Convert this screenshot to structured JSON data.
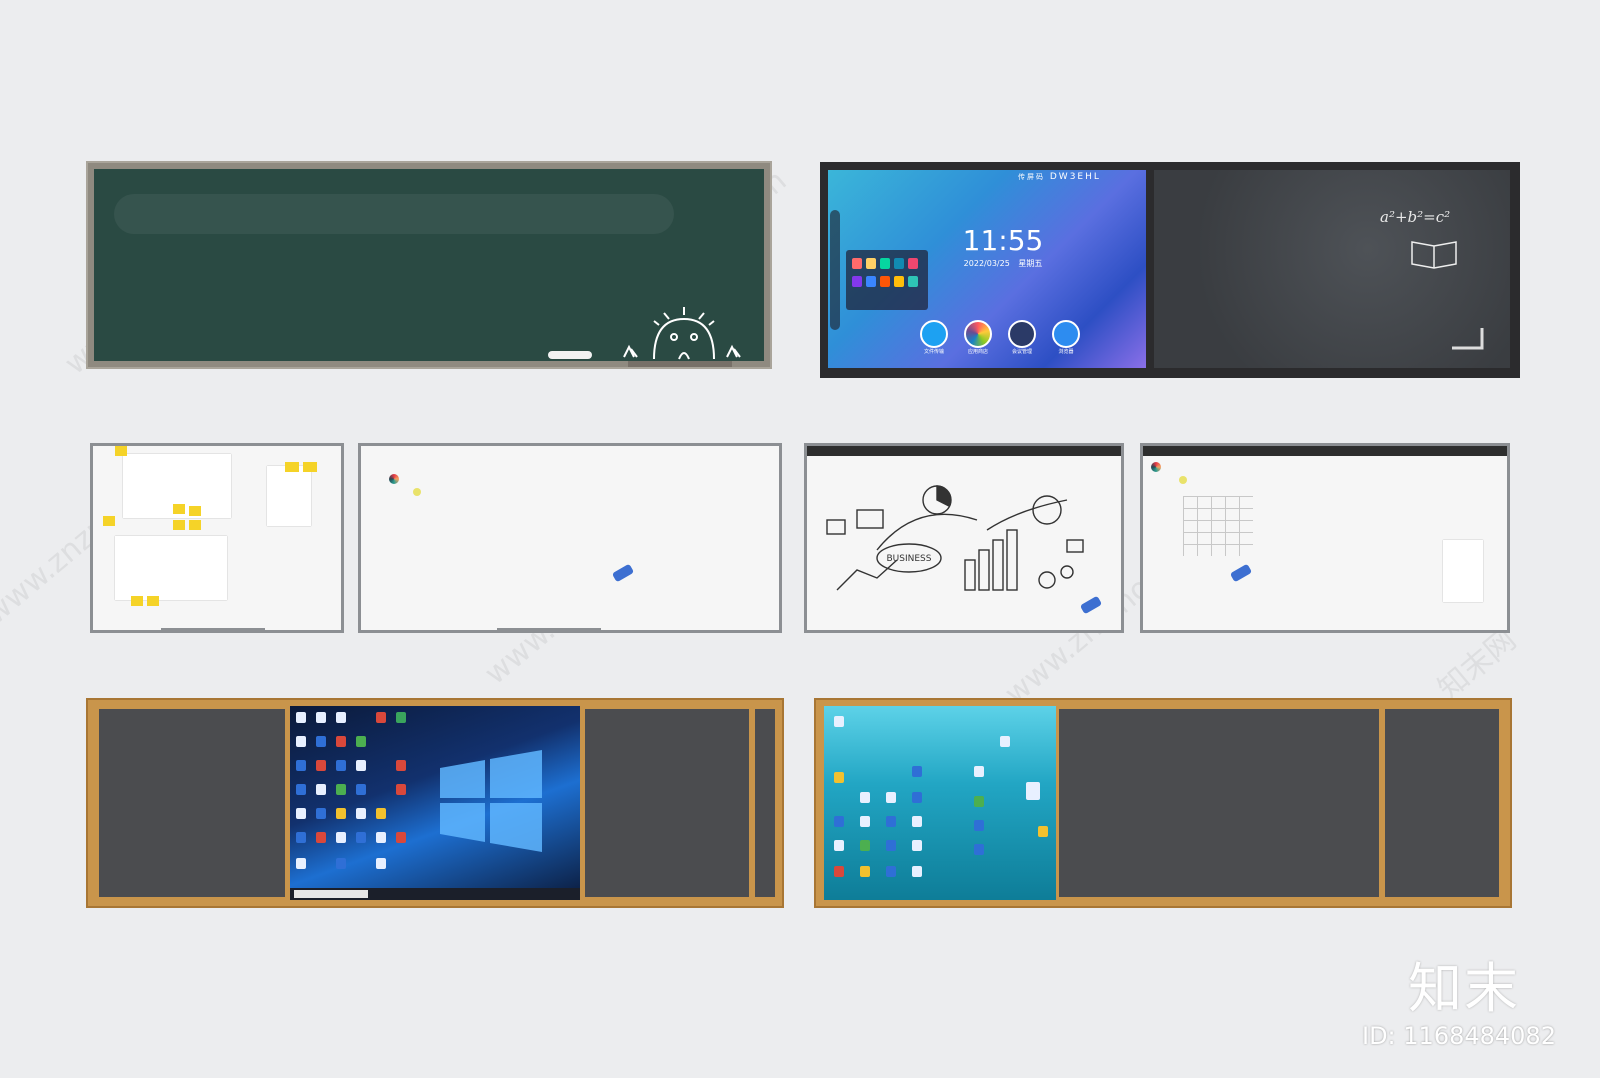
{
  "smart_board": {
    "brand": "DW3EHL",
    "clock_time": "11:55",
    "clock_date": "2022/03/25",
    "clock_weekday": "星期五",
    "formula": "a²+b²=c²",
    "dock_labels": [
      "文件传输",
      "应用商店",
      "会议管理",
      "浏览器"
    ],
    "status_label": "传屏码"
  },
  "business_board": {
    "center_text": "BUSINESS"
  },
  "watermark": {
    "text": "www.znzmo.com",
    "logo": "知末网"
  },
  "footer": {
    "logo": "知末",
    "id_text": "ID: 1168484082"
  },
  "colors": {
    "background": "#ecedef",
    "chalkboard": "#2a4a43",
    "wood": "#c9954b",
    "slate": "#4b4c4f"
  },
  "icons": [
    "chalk-drawing-face-icon",
    "book-icon",
    "eraser-icon",
    "magnet-icon",
    "windows-logo-icon"
  ]
}
